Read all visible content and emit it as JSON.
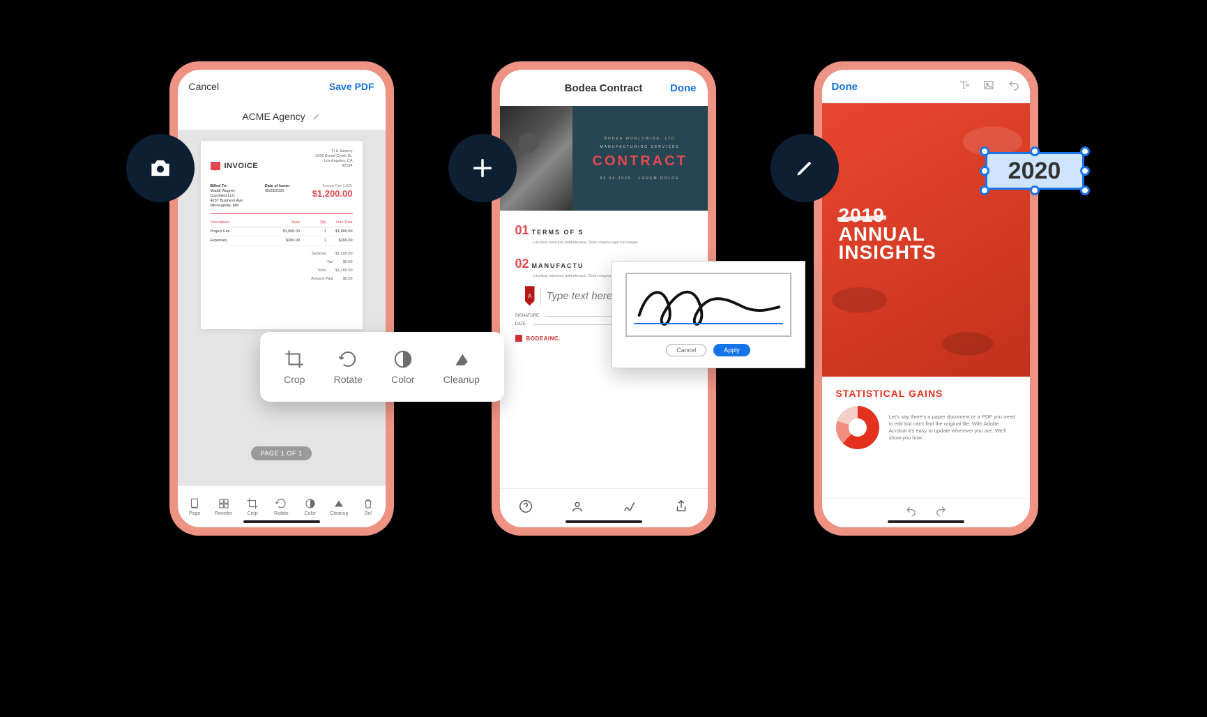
{
  "phone1": {
    "badge_icon": "camera",
    "header": {
      "cancel": "Cancel",
      "save": "Save PDF"
    },
    "doc_title": "ACME Agency",
    "invoice": {
      "company": "TI & Sammy",
      "address1": "2020 Broad Creek Dr.",
      "address2": "Los Angeles, CA",
      "address3": "92294",
      "word": "INVOICE",
      "billed_label": "Billed To:",
      "billed_name": "Maddi Wagner",
      "billed_co": "CozyNest LLC",
      "billed_addr1": "4237 Business Ave",
      "billed_addr2": "Minneapolis, MN",
      "issue_label": "Date of Issue:",
      "issue_date": "05/28/2020",
      "due_label": "Amount Due (USD)",
      "due_amount": "$1,200.00",
      "cols": {
        "desc": "Description",
        "rate": "Rate",
        "qty": "Qty",
        "total": "Line Total"
      },
      "rows": [
        {
          "desc": "Project Fee",
          "rate": "$1,000.00",
          "qty": "1",
          "total": "$1,000.00"
        },
        {
          "desc": "Expenses",
          "rate": "$200.00",
          "qty": "1",
          "total": "$200.00"
        }
      ],
      "totals": [
        {
          "label": "Subtotal",
          "value": "$1,200.00"
        },
        {
          "label": "Tax",
          "value": "$0.00"
        },
        {
          "label": "Total",
          "value": "$1,200.00"
        },
        {
          "label": "Amount Paid",
          "value": "$0.00"
        }
      ]
    },
    "page_indicator": "PAGE 1 OF 1",
    "bottom_tools": [
      {
        "icon": "page",
        "label": "Page"
      },
      {
        "icon": "reorder",
        "label": "Reorder"
      },
      {
        "icon": "crop",
        "label": "Crop"
      },
      {
        "icon": "rotate",
        "label": "Rotate"
      },
      {
        "icon": "color",
        "label": "Color"
      },
      {
        "icon": "cleanup",
        "label": "Cleanup"
      },
      {
        "icon": "delete",
        "label": "Del"
      }
    ],
    "float_tools": [
      {
        "icon": "crop",
        "label": "Crop"
      },
      {
        "icon": "rotate",
        "label": "Rotate"
      },
      {
        "icon": "color",
        "label": "Color"
      },
      {
        "icon": "cleanup",
        "label": "Cleanup"
      }
    ]
  },
  "phone2": {
    "badge_icon": "plus",
    "header": {
      "title": "Bodea Contract",
      "done": "Done"
    },
    "hero": {
      "pre": "BODEA WORLDWIDE, LTD",
      "sub": "MANUFACTURING SERVICES",
      "title": "CONTRACT",
      "date": "03.04.2020",
      "lorem": "LOREM DOLOR"
    },
    "sections": [
      {
        "num": "01",
        "title": "TERMS OF S",
        "body": "Liiscibus interdum pellentesque. Dolor magna eget est integer."
      },
      {
        "num": "02",
        "title": "MANUFACTU",
        "body": "Liiscibus interdum pellentesque. Dolor magna eget est integer."
      }
    ],
    "type_placeholder": "Type text here",
    "signature_label": "SIGNATURE:",
    "date_label": "DATE:",
    "footer": "BODEAINC.",
    "sig_popup": {
      "cancel": "Cancel",
      "apply": "Apply"
    },
    "tool_icons": [
      "help",
      "profile",
      "sign",
      "share"
    ]
  },
  "phone3": {
    "badge_icon": "pencil",
    "header": {
      "done": "Done",
      "icons": [
        "text-tool",
        "image-tool",
        "undo"
      ]
    },
    "hero": {
      "year": "2019",
      "line1": "ANNUAL",
      "line2": "INSIGHTS"
    },
    "selection_year": "2020",
    "stats": {
      "heading": "STATISTICAL GAINS",
      "copy": "Let's say there's a paper document or a PDF you need to edit but can't find the original file. With Adobe Acrobat it's easy to update wherever you are. We'll show you how."
    },
    "footer_icons": [
      "undo",
      "redo"
    ]
  }
}
